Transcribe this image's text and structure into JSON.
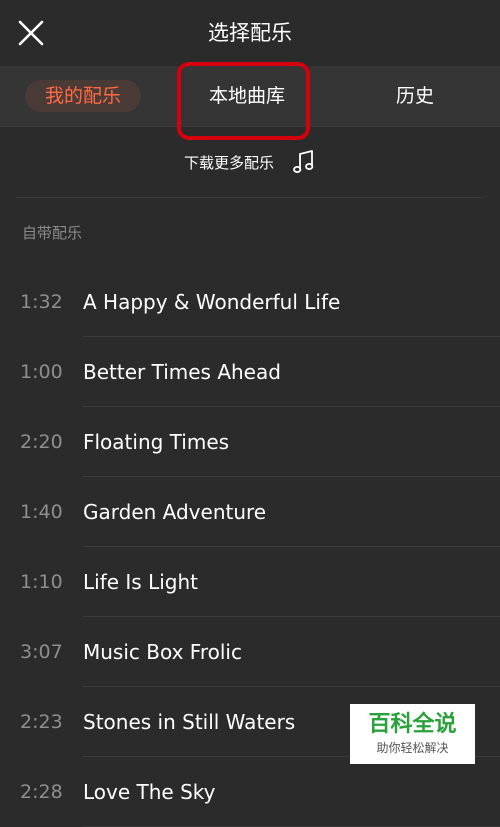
{
  "header": {
    "title": "选择配乐",
    "close_icon": "close-icon"
  },
  "tabs": [
    {
      "label": "我的配乐",
      "active": true
    },
    {
      "label": "本地曲库",
      "active": false,
      "highlighted": true
    },
    {
      "label": "历史",
      "active": false
    }
  ],
  "download": {
    "label": "下载更多配乐",
    "icon": "music-note-icon"
  },
  "section": {
    "label": "自带配乐"
  },
  "songs": [
    {
      "duration": "1:32",
      "title": "A Happy & Wonderful Life"
    },
    {
      "duration": "1:00",
      "title": "Better Times Ahead"
    },
    {
      "duration": "2:20",
      "title": "Floating Times"
    },
    {
      "duration": "1:40",
      "title": "Garden Adventure"
    },
    {
      "duration": "1:10",
      "title": "Life Is Light"
    },
    {
      "duration": "3:07",
      "title": "Music Box Frolic"
    },
    {
      "duration": "2:23",
      "title": "Stones in Still Waters"
    },
    {
      "duration": "2:28",
      "title": "Love The Sky"
    }
  ],
  "watermark": {
    "main": "百科全说",
    "sub": "助你轻松解决"
  },
  "colors": {
    "background": "#2b2b2b",
    "tab_bar": "#353535",
    "accent": "#ff6a45",
    "highlight_box": "#d4000d",
    "watermark_green": "#2aa13a"
  }
}
